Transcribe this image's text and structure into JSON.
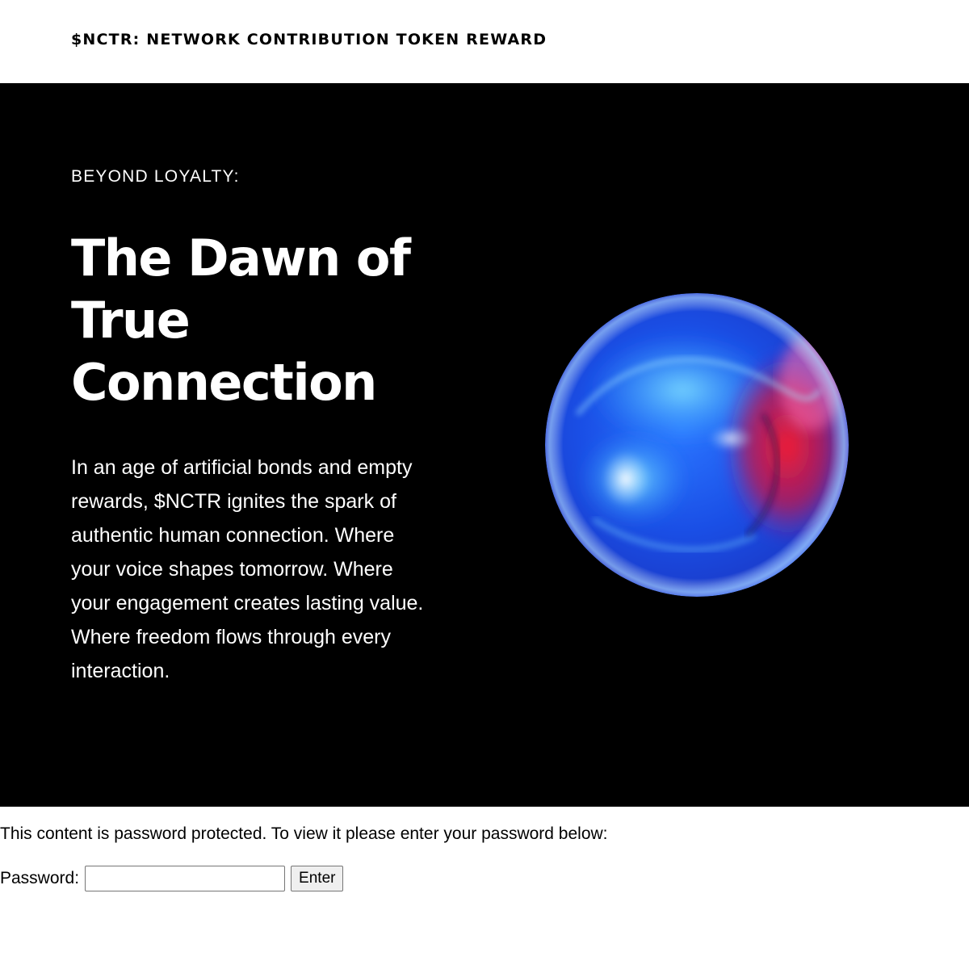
{
  "header": {
    "site_title": "$NCTR: NETWORK CONTRIBUTION TOKEN REWARD"
  },
  "hero": {
    "eyebrow": "BEYOND LOYALTY:",
    "headline_lines": [
      "The Dawn of",
      "True",
      "Connection"
    ],
    "body_lines": [
      "In an age of artificial bonds and empty",
      "rewards, $NCTR ignites the spark of",
      "authentic human connection. Where",
      "your voice shapes tomorrow. Where",
      "your engagement creates lasting value.",
      "Where freedom flows through every",
      "interaction."
    ],
    "background_color": "#000000",
    "orb_colors": {
      "core": "#1f5cf0",
      "highlight": "#39b6ff",
      "accent_red": "#f0142a",
      "accent_pink": "#ff5fa8"
    }
  },
  "protected_form": {
    "message": "This content is password protected. To view it please enter your password below:",
    "password_label": "Password:",
    "password_value": "",
    "password_placeholder": "",
    "submit_label": "Enter"
  }
}
